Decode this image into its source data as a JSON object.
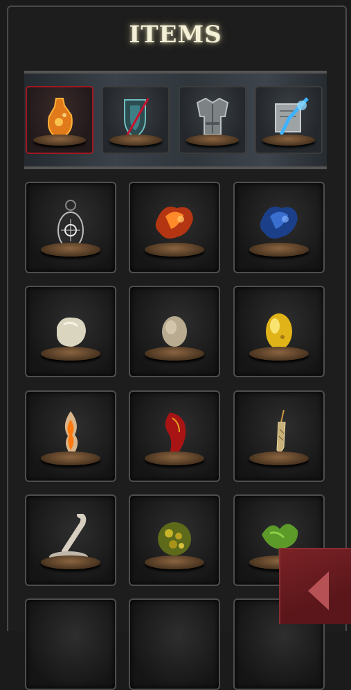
{
  "header": {
    "title": "ITEMS"
  },
  "categories": [
    {
      "name": "consumables",
      "icon": "flask-icon",
      "active": true
    },
    {
      "name": "weapons",
      "icon": "sword-shield-icon",
      "active": false
    },
    {
      "name": "armor",
      "icon": "armor-icon",
      "active": false
    },
    {
      "name": "spells",
      "icon": "scroll-icon",
      "active": false
    }
  ],
  "items": [
    {
      "icon": "talisman-icon"
    },
    {
      "icon": "red-ember-icon"
    },
    {
      "icon": "blue-ember-icon"
    },
    {
      "icon": "white-stone-icon"
    },
    {
      "icon": "pale-stone-icon"
    },
    {
      "icon": "gold-egg-icon"
    },
    {
      "icon": "flame-feather-icon"
    },
    {
      "icon": "red-cloth-icon"
    },
    {
      "icon": "golden-spear-icon"
    },
    {
      "icon": "bone-icon"
    },
    {
      "icon": "moss-clump-icon"
    },
    {
      "icon": "green-herb-icon"
    }
  ],
  "colors": {
    "accent": "#a01822",
    "title_glow": "#f4f0d8",
    "back_button": "#6b1c20"
  },
  "back_button": {
    "icon": "back-arrow-icon"
  }
}
